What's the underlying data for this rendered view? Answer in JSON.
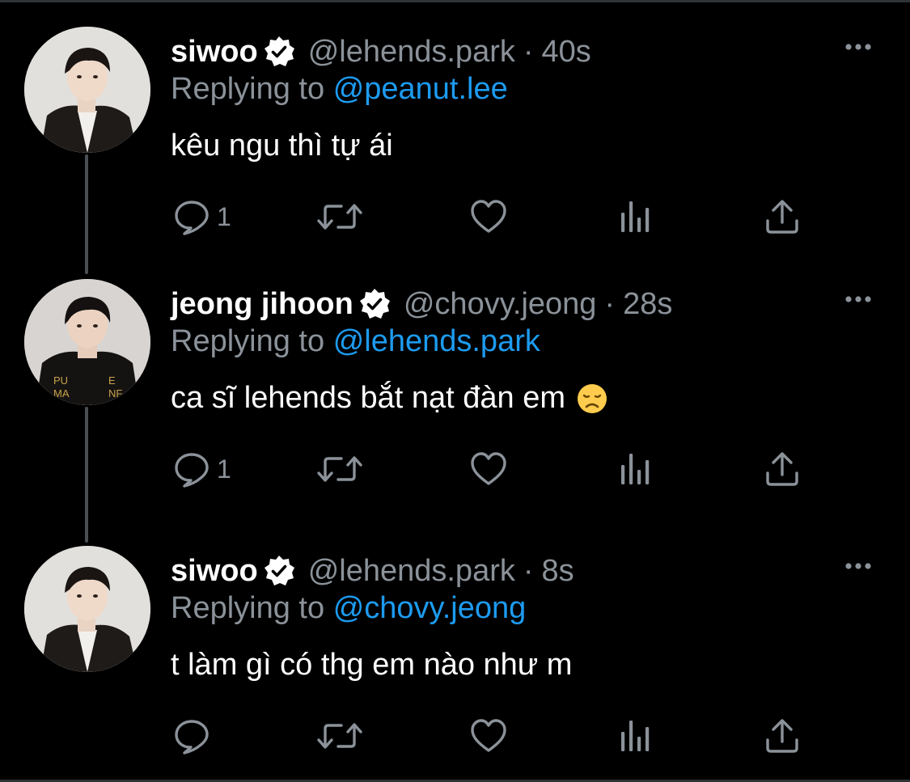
{
  "tweets": [
    {
      "display_name": "siwoo",
      "handle": "@lehends.park",
      "separator": "·",
      "time": "40s",
      "replying_prefix": "Replying to",
      "replying_to": "@peanut.lee",
      "text": "kêu ngu thì tự ái",
      "emoji": "",
      "reply_count": "1",
      "avatar": "person-dark-jacket-avatar"
    },
    {
      "display_name": "jeong jihoon",
      "handle": "@chovy.jeong",
      "separator": "·",
      "time": "28s",
      "replying_prefix": "Replying to",
      "replying_to": "@lehends.park",
      "text": "ca sĩ lehends bắt nạt đàn em",
      "emoji": "disappointed-face-emoji",
      "reply_count": "1",
      "avatar": "person-black-hoodie-avatar"
    },
    {
      "display_name": "siwoo",
      "handle": "@lehends.park",
      "separator": "·",
      "time": "8s",
      "replying_prefix": "Replying to",
      "replying_to": "@chovy.jeong",
      "text": "t làm gì có thg em nào như m",
      "emoji": "",
      "reply_count": "",
      "avatar": "person-dark-jacket-avatar"
    }
  ],
  "icons": {
    "verified": "verified-badge-icon",
    "more": "more-options-icon",
    "reply": "reply-icon",
    "retweet": "retweet-icon",
    "like": "like-heart-icon",
    "views": "views-chart-icon",
    "share": "share-icon"
  },
  "colors": {
    "background": "#000000",
    "primary_text": "#ffffff",
    "secondary_text": "#8b9299",
    "link": "#1d9bf0",
    "thread_line": "#4a4f54"
  }
}
